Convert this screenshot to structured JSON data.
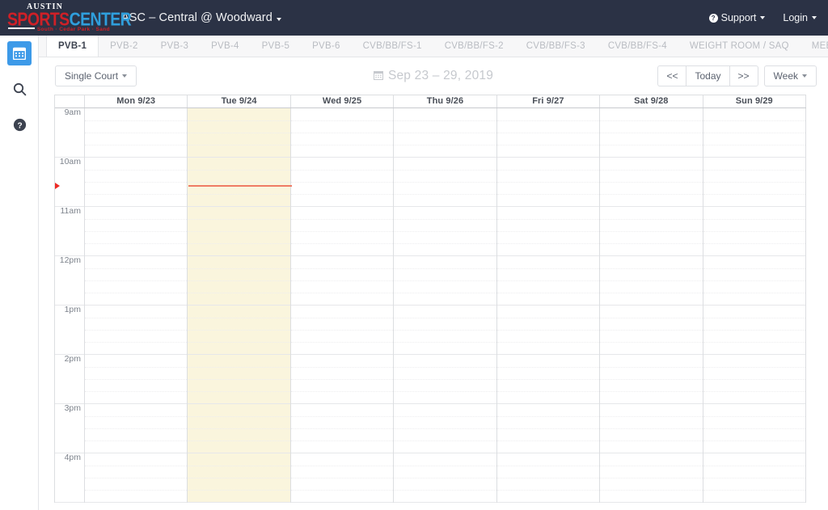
{
  "navbar": {
    "logo": {
      "austin": "AUSTIN",
      "sports": "SPORTS",
      "center": "CENTER",
      "subtitle": "South  ·  Cedar Park  ·  Sand"
    },
    "facility_selector": "ASC – Central @ Woodward",
    "support_label": "Support",
    "support_icon": "question-circle-icon",
    "login_label": "Login"
  },
  "sidebar": {
    "items": [
      {
        "name": "calendar",
        "icon": "calendar-icon",
        "active": true
      },
      {
        "name": "search",
        "icon": "search-icon",
        "active": false
      },
      {
        "name": "help",
        "icon": "question-circle-icon",
        "active": false
      }
    ]
  },
  "tabs": [
    {
      "label": "PVB-1",
      "active": true
    },
    {
      "label": "PVB-2",
      "active": false
    },
    {
      "label": "PVB-3",
      "active": false
    },
    {
      "label": "PVB-4",
      "active": false
    },
    {
      "label": "PVB-5",
      "active": false
    },
    {
      "label": "PVB-6",
      "active": false
    },
    {
      "label": "CVB/BB/FS-1",
      "active": false
    },
    {
      "label": "CVB/BB/FS-2",
      "active": false
    },
    {
      "label": "CVB/BB/FS-3",
      "active": false
    },
    {
      "label": "CVB/BB/FS-4",
      "active": false
    },
    {
      "label": "WEIGHT ROOM / SAQ",
      "active": false
    },
    {
      "label": "MEETING ROOM",
      "active": false
    }
  ],
  "toolbar": {
    "court_mode": "Single Court",
    "date_range": "Sep 23 – 29, 2019",
    "calendar_icon": "calendar-icon",
    "prev_label": "<<",
    "today_label": "Today",
    "next_label": ">>",
    "view_label": "Week"
  },
  "calendar": {
    "days": [
      {
        "label": "Mon 9/23",
        "today": false
      },
      {
        "label": "Tue 9/24",
        "today": true
      },
      {
        "label": "Wed 9/25",
        "today": false
      },
      {
        "label": "Thu 9/26",
        "today": false
      },
      {
        "label": "Fri 9/27",
        "today": false
      },
      {
        "label": "Sat 9/28",
        "today": false
      },
      {
        "label": "Sun 9/29",
        "today": false
      }
    ],
    "hours": [
      "9am",
      "10am",
      "11am",
      "12pm",
      "1pm",
      "2pm",
      "3pm",
      "4pm"
    ],
    "current_time_marker": {
      "hour_index": 1,
      "minute_offset": 33,
      "day_index": 1,
      "color": "#ef7b65",
      "arrow_color": "#ee2a24"
    },
    "events": []
  },
  "colors": {
    "navbar_bg": "#2b3245",
    "accent_blue": "#3d9ae8",
    "brand_red": "#cf2027",
    "brand_blue": "#2f9fdd",
    "today_bg": "#faf5dd",
    "grid_line": "#dcdee1"
  }
}
